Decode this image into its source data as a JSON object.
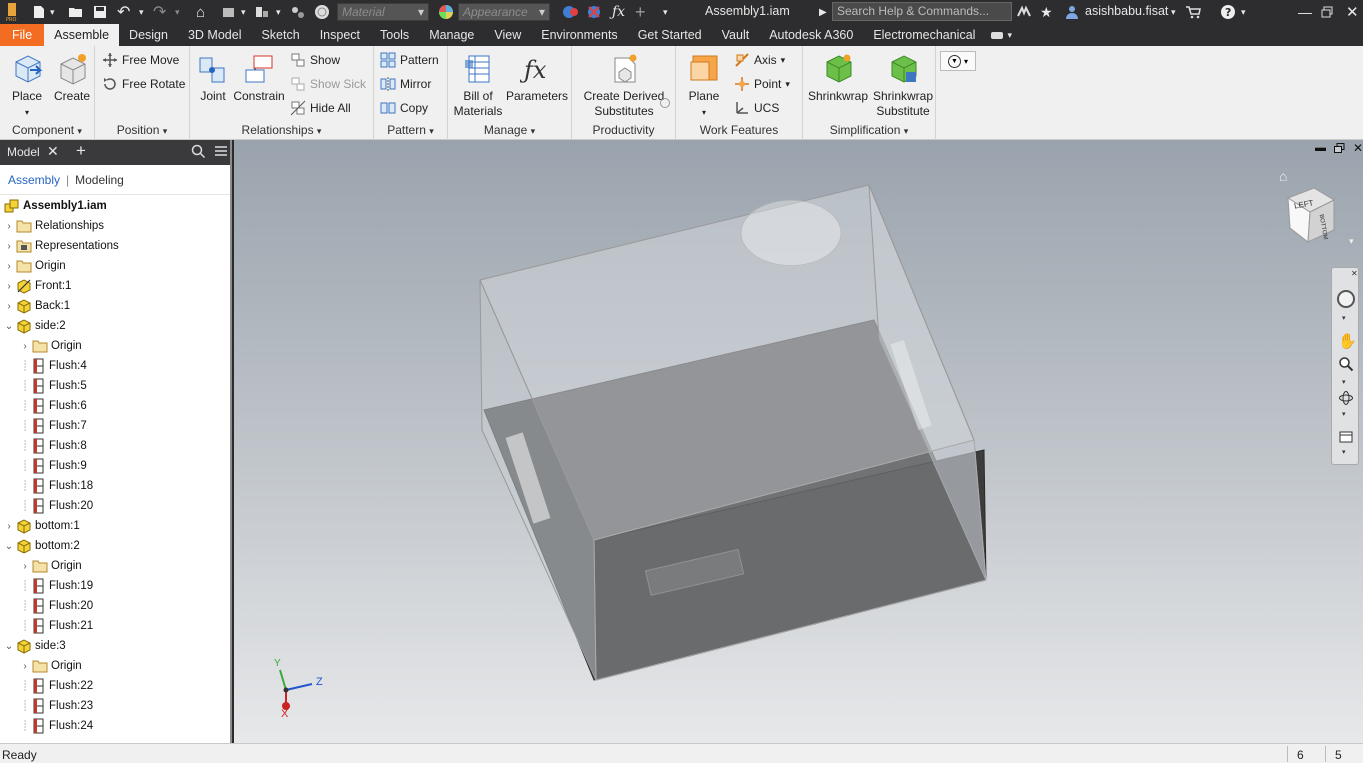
{
  "titlebar": {
    "material_placeholder": "Material",
    "appearance_placeholder": "Appearance",
    "doc_title": "Assembly1.iam",
    "search_placeholder": "Search Help & Commands...",
    "user": "asishbabu.fisat"
  },
  "tabs": [
    "File",
    "Assemble",
    "Design",
    "3D Model",
    "Sketch",
    "Inspect",
    "Tools",
    "Manage",
    "View",
    "Environments",
    "Get Started",
    "Vault",
    "Autodesk A360",
    "Electromechanical"
  ],
  "active_tab": "Assemble",
  "ribbon": {
    "component": {
      "label": "Component",
      "place": "Place",
      "create": "Create"
    },
    "position": {
      "label": "Position",
      "free_move": "Free Move",
      "free_rotate": "Free Rotate"
    },
    "relationships": {
      "label": "Relationships",
      "joint": "Joint",
      "constrain": "Constrain",
      "show": "Show",
      "show_sick": "Show Sick",
      "hide_all": "Hide All"
    },
    "pattern": {
      "label": "Pattern",
      "pattern": "Pattern",
      "mirror": "Mirror",
      "copy": "Copy"
    },
    "manage": {
      "label": "Manage",
      "bom_line1": "Bill of",
      "bom_line2": "Materials",
      "parameters": "Parameters"
    },
    "productivity": {
      "label": "Productivity",
      "cds_line1": "Create Derived",
      "cds_line2": "Substitutes"
    },
    "work_features": {
      "label": "Work Features",
      "plane": "Plane",
      "axis": "Axis",
      "point": "Point",
      "ucs": "UCS"
    },
    "simplification": {
      "label": "Simplification",
      "shrinkwrap": "Shrinkwrap",
      "shrinkwrap_sub_line1": "Shrinkwrap",
      "shrinkwrap_sub_line2": "Substitute"
    }
  },
  "browser": {
    "tab_label": "Model",
    "sub_assembly": "Assembly",
    "sub_modeling": "Modeling",
    "tree": [
      {
        "label": "Assembly1.iam",
        "level": 0,
        "icon": "assembly-icon",
        "bold": true
      },
      {
        "label": "Relationships",
        "level": 1,
        "icon": "folder-icon"
      },
      {
        "label": "Representations",
        "level": 1,
        "icon": "representations-icon"
      },
      {
        "label": "Origin",
        "level": 1,
        "icon": "folder-icon"
      },
      {
        "label": "Front:1",
        "level": 1,
        "icon": "part-grounded-icon"
      },
      {
        "label": "Back:1",
        "level": 1,
        "icon": "part-icon"
      },
      {
        "label": "side:2",
        "level": 1,
        "icon": "part-icon",
        "expanded": true
      },
      {
        "label": "Origin",
        "level": 2,
        "icon": "folder-icon"
      },
      {
        "label": "Flush:4",
        "level": 2,
        "icon": "flush-icon"
      },
      {
        "label": "Flush:5",
        "level": 2,
        "icon": "flush-icon"
      },
      {
        "label": "Flush:6",
        "level": 2,
        "icon": "flush-icon"
      },
      {
        "label": "Flush:7",
        "level": 2,
        "icon": "flush-icon"
      },
      {
        "label": "Flush:8",
        "level": 2,
        "icon": "flush-icon"
      },
      {
        "label": "Flush:9",
        "level": 2,
        "icon": "flush-icon"
      },
      {
        "label": "Flush:18",
        "level": 2,
        "icon": "flush-icon"
      },
      {
        "label": "Flush:20",
        "level": 2,
        "icon": "flush-icon"
      },
      {
        "label": "bottom:1",
        "level": 1,
        "icon": "part-icon"
      },
      {
        "label": "bottom:2",
        "level": 1,
        "icon": "part-icon",
        "expanded": true
      },
      {
        "label": "Origin",
        "level": 2,
        "icon": "folder-icon"
      },
      {
        "label": "Flush:19",
        "level": 2,
        "icon": "flush-icon"
      },
      {
        "label": "Flush:20",
        "level": 2,
        "icon": "flush-icon"
      },
      {
        "label": "Flush:21",
        "level": 2,
        "icon": "flush-icon"
      },
      {
        "label": "side:3",
        "level": 1,
        "icon": "part-icon",
        "expanded": true
      },
      {
        "label": "Origin",
        "level": 2,
        "icon": "folder-icon"
      },
      {
        "label": "Flush:22",
        "level": 2,
        "icon": "flush-icon"
      },
      {
        "label": "Flush:23",
        "level": 2,
        "icon": "flush-icon"
      },
      {
        "label": "Flush:24",
        "level": 2,
        "icon": "flush-icon"
      }
    ]
  },
  "viewport": {
    "viewcube_face": "LEFT",
    "viewcube_side_face": "BOTTOM",
    "axis_x": "X",
    "axis_y": "Y",
    "axis_z": "Z"
  },
  "status": {
    "text": "Ready",
    "count1": "6",
    "count2": "5"
  },
  "colors": {
    "file_tab": "#f26d21",
    "titlebar": "#2d2d30",
    "ribbon": "#f0f0f0",
    "viewport_top": "#9aa3ad",
    "viewport_bottom": "#e7e8ea"
  }
}
